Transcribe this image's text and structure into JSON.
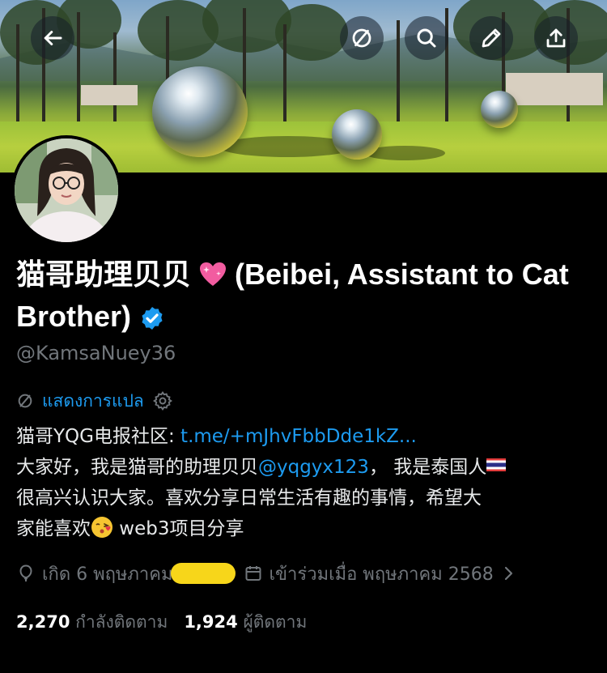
{
  "toolbar": {
    "back_icon": "arrow-left-icon",
    "mute_icon": "slash-circle-icon",
    "search_icon": "search-icon",
    "edit_icon": "pencil-icon",
    "share_icon": "share-icon"
  },
  "profile": {
    "name": "猫哥助理贝贝",
    "name_en": "(Beibei, Assistant to Cat Brother)",
    "verified": true,
    "handle": "@KamsaNuey36",
    "translate_label": "แสดงการแปล",
    "bio_line1_prefix": "猫哥YQG电报社区: ",
    "bio_line1_link": "t.me/+mJhvFbbDde1kZ...",
    "bio_line2_prefix": "大家好，我是猫哥的助理贝贝",
    "bio_line2_mention": "@yqgyx123",
    "bio_line2_suffix": "， 我是泰国人",
    "bio_line3": "很高兴认识大家。喜欢分享日常生活有趣的事情，希望大",
    "bio_line4_prefix": "家能喜欢",
    "bio_line4_suffix": " web3项目分享",
    "birth_label": "เกิด 6 พฤษภาคม 2",
    "joined_label": "เข้าร่วมเมื่อ พฤษภาคม 2568"
  },
  "stats": {
    "following_count": "2,270",
    "following_label": "กำลังติดตาม",
    "followers_count": "1,924",
    "followers_label": "ผู้ติดตาม"
  },
  "colors": {
    "accent": "#1d9bf0",
    "muted": "#71767b",
    "background": "#000000"
  }
}
